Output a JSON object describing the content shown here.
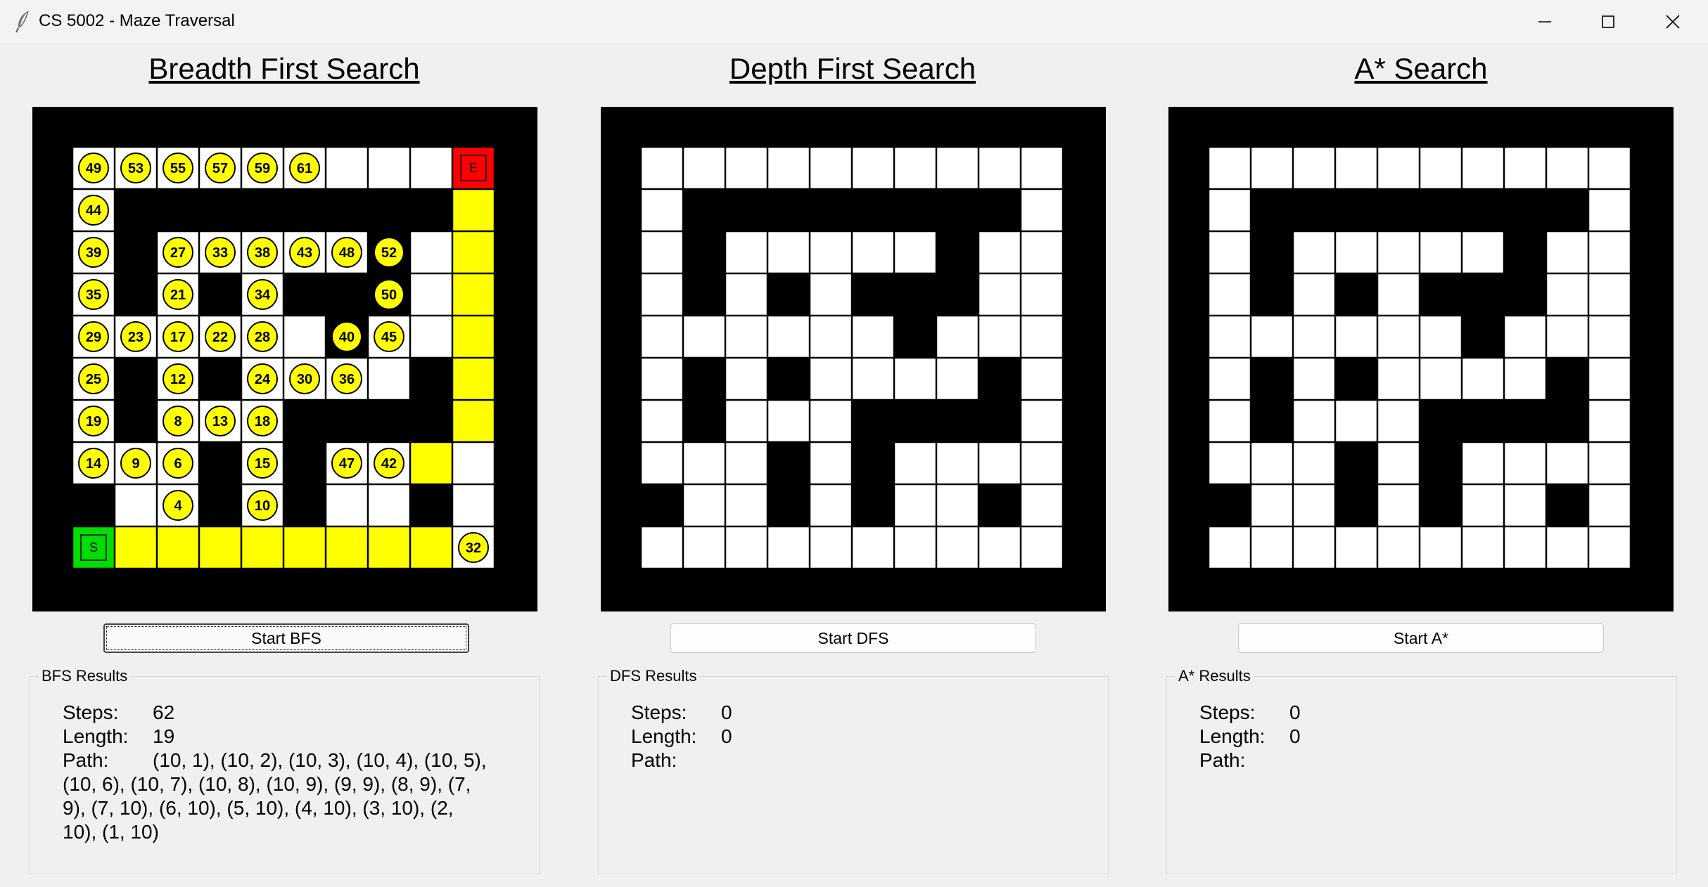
{
  "window": {
    "title": "CS 5002 - Maze Traversal",
    "icon": "feather-icon",
    "controls": [
      "minimize-icon",
      "maximize-icon",
      "close-icon"
    ]
  },
  "colors": {
    "wall": "#000000",
    "open": "#ffffff",
    "path": "#ffff00",
    "visited_marker": "#ffff00",
    "start": "#00dd00",
    "end": "#ff0000"
  },
  "maze": {
    "size": 12,
    "rows": [
      "############",
      "#..........#",
      "#.########.#",
      "#.#.....#..#",
      "#.#.#.###..#",
      "#......#...#",
      "#.#.#....#.#",
      "#.#...####.#",
      "#...#.#....#",
      "##..#.#..#.#",
      "#..........#",
      "############"
    ]
  },
  "panels": [
    {
      "id": "bfs",
      "title": "Breadth First Search",
      "button": "Start BFS",
      "results_title": "BFS Results",
      "steps_label": "Steps:",
      "steps": "62",
      "length_label": "Length:",
      "length": "19",
      "path_label": "Path:",
      "path": "(10, 1), (10, 2), (10, 3), (10, 4), (10, 5), (10, 6), (10, 7), (10, 8), (10, 9), (9, 9), (8, 9), (7, 9), (7, 10), (6, 10), (5, 10), (4, 10), (3, 10), (2, 10), (1, 10)",
      "start_label": "S",
      "end_label": "E",
      "start_cell": [
        10,
        1
      ],
      "end_cell": [
        1,
        10
      ],
      "path_cells": [
        [
          10,
          2
        ],
        [
          10,
          3
        ],
        [
          10,
          4
        ],
        [
          10,
          5
        ],
        [
          10,
          6
        ],
        [
          10,
          7
        ],
        [
          10,
          8
        ],
        [
          10,
          9
        ],
        [
          9,
          9
        ],
        [
          8,
          9
        ],
        [
          7,
          9
        ],
        [
          7,
          10
        ],
        [
          6,
          10
        ],
        [
          5,
          10
        ],
        [
          4,
          10
        ],
        [
          3,
          10
        ],
        [
          2,
          10
        ]
      ],
      "visited": [
        {
          "r": 1,
          "c": 1,
          "n": "49"
        },
        {
          "r": 1,
          "c": 2,
          "n": "53"
        },
        {
          "r": 1,
          "c": 3,
          "n": "55"
        },
        {
          "r": 1,
          "c": 4,
          "n": "57"
        },
        {
          "r": 1,
          "c": 5,
          "n": "59"
        },
        {
          "r": 1,
          "c": 6,
          "n": "61"
        },
        {
          "r": 2,
          "c": 1,
          "n": "44"
        },
        {
          "r": 3,
          "c": 1,
          "n": "39"
        },
        {
          "r": 3,
          "c": 3,
          "n": "27"
        },
        {
          "r": 3,
          "c": 4,
          "n": "33"
        },
        {
          "r": 3,
          "c": 5,
          "n": "38"
        },
        {
          "r": 3,
          "c": 6,
          "n": "43"
        },
        {
          "r": 3,
          "c": 7,
          "n": "48"
        },
        {
          "r": 3,
          "c": 8,
          "n": "52"
        },
        {
          "r": 4,
          "c": 1,
          "n": "35"
        },
        {
          "r": 4,
          "c": 3,
          "n": "21"
        },
        {
          "r": 4,
          "c": 5,
          "n": "34"
        },
        {
          "r": 4,
          "c": 8,
          "n": "50"
        },
        {
          "r": 5,
          "c": 1,
          "n": "29"
        },
        {
          "r": 5,
          "c": 2,
          "n": "23"
        },
        {
          "r": 5,
          "c": 3,
          "n": "17"
        },
        {
          "r": 5,
          "c": 4,
          "n": "22"
        },
        {
          "r": 5,
          "c": 5,
          "n": "28"
        },
        {
          "r": 5,
          "c": 7,
          "n": "40"
        },
        {
          "r": 5,
          "c": 8,
          "n": "45"
        },
        {
          "r": 6,
          "c": 1,
          "n": "25"
        },
        {
          "r": 6,
          "c": 3,
          "n": "12"
        },
        {
          "r": 6,
          "c": 5,
          "n": "24"
        },
        {
          "r": 6,
          "c": 6,
          "n": "30"
        },
        {
          "r": 6,
          "c": 7,
          "n": "36"
        },
        {
          "r": 7,
          "c": 1,
          "n": "19"
        },
        {
          "r": 7,
          "c": 3,
          "n": "8"
        },
        {
          "r": 7,
          "c": 4,
          "n": "13"
        },
        {
          "r": 7,
          "c": 5,
          "n": "18"
        },
        {
          "r": 8,
          "c": 1,
          "n": "14"
        },
        {
          "r": 8,
          "c": 2,
          "n": "9"
        },
        {
          "r": 8,
          "c": 3,
          "n": "6"
        },
        {
          "r": 8,
          "c": 5,
          "n": "15"
        },
        {
          "r": 8,
          "c": 7,
          "n": "47"
        },
        {
          "r": 8,
          "c": 8,
          "n": "42"
        },
        {
          "r": 9,
          "c": 3,
          "n": "4"
        },
        {
          "r": 9,
          "c": 5,
          "n": "10"
        },
        {
          "r": 10,
          "c": 10,
          "n": "32"
        }
      ]
    },
    {
      "id": "dfs",
      "title": "Depth First Search",
      "button": "Start DFS",
      "results_title": "DFS Results",
      "steps_label": "Steps:",
      "steps": "0",
      "length_label": "Length:",
      "length": "0",
      "path_label": "Path:",
      "path": ""
    },
    {
      "id": "astar",
      "title": "A* Search",
      "button": "Start A*",
      "results_title": "A* Results",
      "steps_label": "Steps:",
      "steps": "0",
      "length_label": "Length:",
      "length": "0",
      "path_label": "Path:",
      "path": ""
    }
  ]
}
